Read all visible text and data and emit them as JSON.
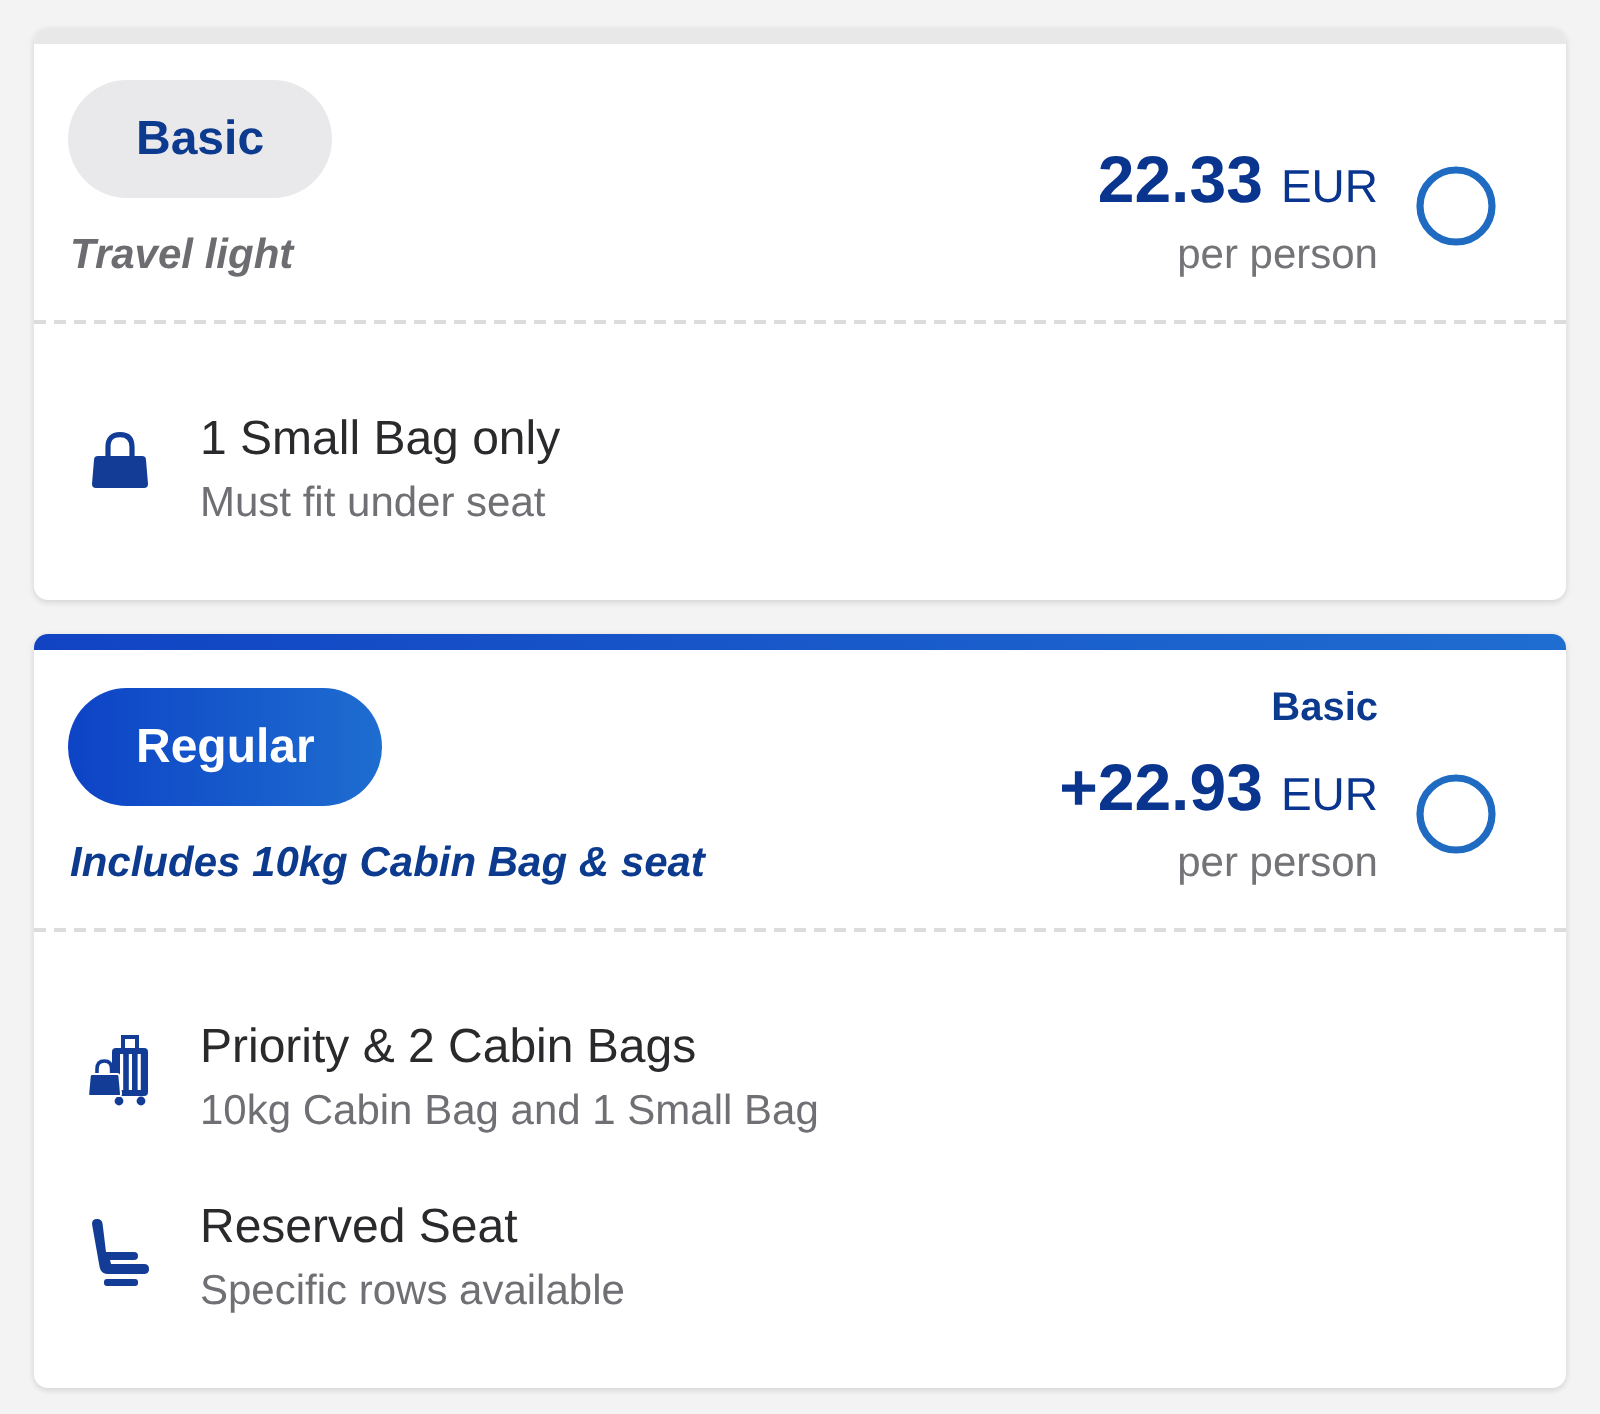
{
  "fares": [
    {
      "name": "Basic",
      "tagline": "Travel light",
      "highlighted": false,
      "price": "22.33",
      "currency": "EUR",
      "price_unit": "per person",
      "selected": false,
      "features": [
        {
          "kind": "small-bag",
          "title": "1 Small Bag only",
          "detail": "Must fit under seat"
        }
      ]
    },
    {
      "name": "Regular",
      "tagline": "Includes 10kg Cabin Bag & seat",
      "highlighted": true,
      "price_caption": "Basic",
      "price": "+22.93",
      "currency": "EUR",
      "price_unit": "per person",
      "selected": false,
      "features": [
        {
          "kind": "cabin-bags",
          "title": "Priority & 2 Cabin Bags",
          "detail": "10kg Cabin Bag and 1 Small Bag"
        },
        {
          "kind": "seat",
          "title": "Reserved Seat",
          "detail": "Specific rows available"
        }
      ]
    }
  ]
}
